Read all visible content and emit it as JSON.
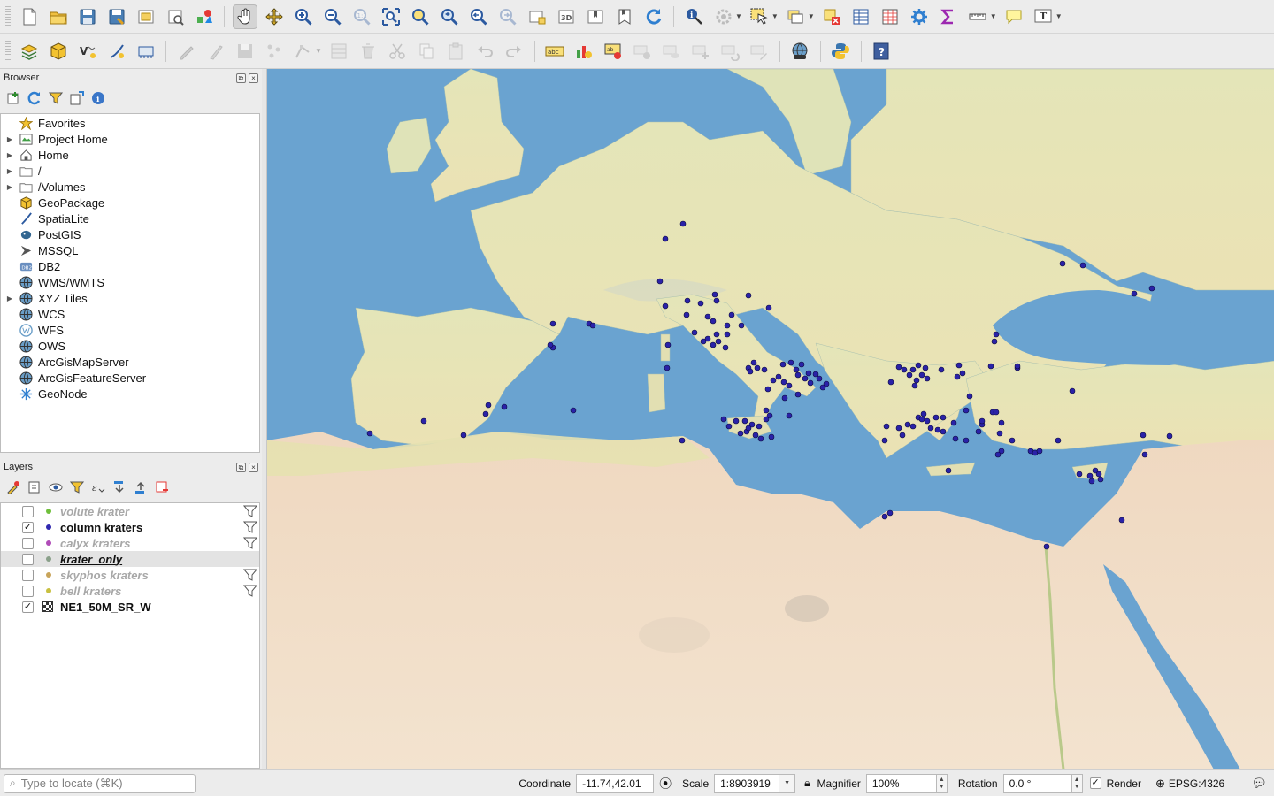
{
  "toolbar1": {
    "buttons": [
      "new-project",
      "open-project",
      "save-project",
      "save-as",
      "new-print-layout",
      "layout-manager",
      "style-manager",
      "pan-map",
      "pan-to-selection",
      "zoom-in",
      "zoom-out",
      "zoom-native",
      "zoom-full",
      "zoom-to-selection",
      "zoom-to-layer",
      "zoom-last",
      "zoom-next",
      "new-map-view",
      "new-3d-view",
      "new-bookmark",
      "show-bookmarks",
      "refresh",
      "identify",
      "run-action",
      "select-features",
      "select-by-value",
      "deselect-all",
      "attribute-table",
      "field-calculator",
      "toolbox",
      "statistics",
      "measure",
      "map-tips",
      "text-annotation"
    ]
  },
  "toolbar2": {
    "buttons": [
      "data-source-manager",
      "new-geopackage-layer",
      "new-shapefile-layer",
      "new-spatialite-layer",
      "new-virtual-layer",
      "current-edits",
      "toggle-editing",
      "save-edits",
      "add-feature",
      "vertex-tool",
      "modify-attributes",
      "delete-selected",
      "cut-features",
      "copy-features",
      "paste-features",
      "undo",
      "redo",
      "layer-labeling",
      "layer-diagram",
      "highlight-pinned",
      "pin-labels",
      "show-hide-labels",
      "move-label",
      "rotate-label",
      "change-label",
      "plugin-globe",
      "python-console",
      "help"
    ]
  },
  "browser": {
    "title": "Browser",
    "items": [
      {
        "label": "Favorites",
        "icon": "star-icon",
        "expand": false
      },
      {
        "label": "Project Home",
        "icon": "project-home-icon",
        "expand": true
      },
      {
        "label": "Home",
        "icon": "home-icon",
        "expand": true
      },
      {
        "label": "/",
        "icon": "folder-icon",
        "expand": true
      },
      {
        "label": "/Volumes",
        "icon": "folder-icon",
        "expand": true
      },
      {
        "label": "GeoPackage",
        "icon": "geopackage-icon",
        "expand": false
      },
      {
        "label": "SpatiaLite",
        "icon": "spatialite-icon",
        "expand": false
      },
      {
        "label": "PostGIS",
        "icon": "postgis-icon",
        "expand": false
      },
      {
        "label": "MSSQL",
        "icon": "mssql-icon",
        "expand": false
      },
      {
        "label": "DB2",
        "icon": "db2-icon",
        "expand": false
      },
      {
        "label": "WMS/WMTS",
        "icon": "globe-icon",
        "expand": false
      },
      {
        "label": "XYZ Tiles",
        "icon": "globe-icon",
        "expand": true
      },
      {
        "label": "WCS",
        "icon": "globe-icon",
        "expand": false
      },
      {
        "label": "WFS",
        "icon": "wfs-icon",
        "expand": false
      },
      {
        "label": "OWS",
        "icon": "globe-icon",
        "expand": false
      },
      {
        "label": "ArcGisMapServer",
        "icon": "globe-icon",
        "expand": false
      },
      {
        "label": "ArcGisFeatureServer",
        "icon": "globe-icon",
        "expand": false
      },
      {
        "label": "GeoNode",
        "icon": "geonode-icon",
        "expand": false
      }
    ]
  },
  "layers": {
    "title": "Layers",
    "items": [
      {
        "label": "volute krater",
        "checked": false,
        "dot": "#6fbf3b",
        "filter": true,
        "style": "off"
      },
      {
        "label": "column kraters",
        "checked": true,
        "dot": "#3028b0",
        "filter": true,
        "style": "on"
      },
      {
        "label": "calyx kraters",
        "checked": false,
        "dot": "#b04cb8",
        "filter": true,
        "style": "off"
      },
      {
        "label": "krater_only",
        "checked": false,
        "dot": "#8aa08a",
        "filter": false,
        "style": "under"
      },
      {
        "label": "skyphos kraters",
        "checked": false,
        "dot": "#c8a45a",
        "filter": true,
        "style": "off"
      },
      {
        "label": "bell kraters",
        "checked": false,
        "dot": "#c8c040",
        "filter": true,
        "style": "off"
      },
      {
        "label": "NE1_50M_SR_W",
        "checked": true,
        "dot": "",
        "filter": false,
        "style": "raster"
      }
    ]
  },
  "statusbar": {
    "locator_placeholder": "Type to locate (⌘K)",
    "coordinate_label": "Coordinate",
    "coordinate_value": "-11.74,42.01",
    "scale_label": "Scale",
    "scale_value": "1:8903919",
    "magnifier_label": "Magnifier",
    "magnifier_value": "100%",
    "rotation_label": "Rotation",
    "rotation_value": "0.0 °",
    "render_label": "Render",
    "render_checked": true,
    "crs_label": "EPSG:4326"
  },
  "map": {
    "layer_color": "#2a22a8",
    "sea_color": "#5d9fcf",
    "land_color": "#e8e3b0"
  }
}
